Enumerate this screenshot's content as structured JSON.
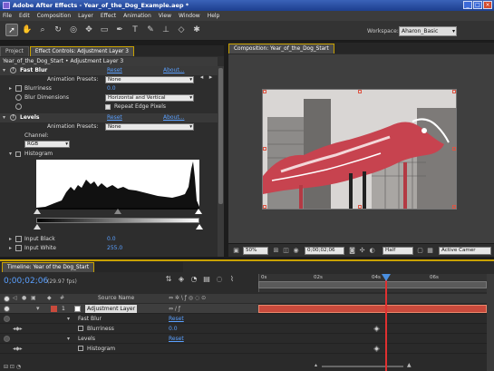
{
  "window": {
    "title": "Adobe After Effects - Year_of_the_Dog_Example.aep *"
  },
  "menu": [
    "File",
    "Edit",
    "Composition",
    "Layer",
    "Effect",
    "Animation",
    "View",
    "Window",
    "Help"
  ],
  "toolbar": {
    "tools": [
      "selection-tool-icon",
      "hand-tool-icon",
      "zoom-tool-icon",
      "rotation-tool-icon",
      "orbit-camera-tool-icon",
      "pan-behind-tool-icon",
      "pen-tool-icon",
      "type-tool-icon",
      "brush-tool-icon",
      "clone-stamp-tool-icon",
      "eraser-tool-icon",
      "puppet-pin-tool-icon"
    ],
    "workspace_label": "Workspace:",
    "workspace_value": "Aharon_Basic"
  },
  "left_panel": {
    "tabs": [
      "Project",
      "Effect Controls: Adjustment Layer 3"
    ],
    "header": "Year_of_the_Dog_Start • Adjustment Layer 3",
    "fast_blur": {
      "name": "Fast Blur",
      "reset": "Reset",
      "about": "About...",
      "presets_label": "Animation Presets:",
      "presets_value": "None",
      "blurriness_label": "Blurriness",
      "blurriness_value": "0.0",
      "dimensions_label": "Blur Dimensions",
      "dimensions_value": "Horizontal and Vertical",
      "repeat_label": "Repeat Edge Pixels"
    },
    "levels": {
      "name": "Levels",
      "reset": "Reset",
      "about": "About...",
      "presets_label": "Animation Presets:",
      "presets_value": "None",
      "channel_label": "Channel:",
      "channel_value": "RGB",
      "histogram_label": "Histogram",
      "input_black_label": "Input Black",
      "input_black_value": "0.0",
      "input_white_label": "Input White",
      "input_white_value": "255.0"
    }
  },
  "composition": {
    "tab": "Composition: Year_of_the_Dog_Start",
    "zoom": "50%",
    "timecode": "0;00;02;06",
    "resolution": "Half",
    "camera": "Active Camer"
  },
  "timeline": {
    "tab": "Timeline: Year of the Dog_Start",
    "current_time": "0;00;02;06",
    "fps": "(29.97 fps)",
    "ruler_ticks": [
      "0s",
      "02s",
      "04s",
      "06s"
    ],
    "col_source": "Source Name",
    "layer": {
      "number": "1",
      "name": "Adjustment Layer"
    },
    "props": [
      {
        "name": "Fast Blur",
        "value": "Reset"
      },
      {
        "name": "Blurriness",
        "value": "0.0"
      },
      {
        "name": "Levels",
        "value": "Reset"
      },
      {
        "name": "Histogram",
        "value": ""
      }
    ]
  }
}
